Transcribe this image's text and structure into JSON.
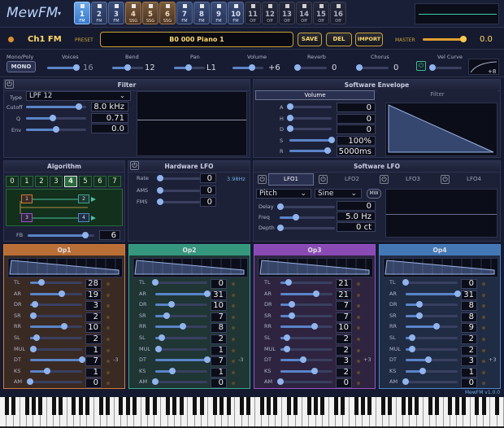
{
  "app": {
    "logo": "MewFM",
    "version": "MewFM v1.0.0"
  },
  "channel_tabs": [
    {
      "num": "1",
      "type": "FM",
      "state": "selected"
    },
    {
      "num": "2",
      "type": "FM",
      "state": "fm"
    },
    {
      "num": "3",
      "type": "FM",
      "state": "fm"
    },
    {
      "num": "4",
      "type": "SSG",
      "state": "ssg"
    },
    {
      "num": "5",
      "type": "SSG",
      "state": "ssg"
    },
    {
      "num": "6",
      "type": "SSG",
      "state": "ssg"
    },
    {
      "num": "7",
      "type": "FM",
      "state": "fm"
    },
    {
      "num": "8",
      "type": "FM",
      "state": "fm"
    },
    {
      "num": "9",
      "type": "FM",
      "state": "fm"
    },
    {
      "num": "10",
      "type": "FM",
      "state": "fm"
    },
    {
      "num": "11",
      "type": "Off",
      "state": "off"
    },
    {
      "num": "12",
      "type": "Off",
      "state": "off"
    },
    {
      "num": "13",
      "type": "Off",
      "state": "off"
    },
    {
      "num": "14",
      "type": "Off",
      "state": "off"
    },
    {
      "num": "15",
      "type": "Off",
      "state": "off"
    },
    {
      "num": "16",
      "type": "Off",
      "state": "off"
    }
  ],
  "preset_bar": {
    "channel_name": "Ch1 FM",
    "preset_label": "PRESET",
    "preset_value": "B0 000 Piano 1",
    "save": "SAVE",
    "del": "DEL",
    "import": "IMPORT",
    "master_label": "MASTER",
    "master_value": "0.0",
    "master_level": 0.93
  },
  "globals": {
    "mono_poly_label": "Mono/Poly",
    "mono_btn": "MONO",
    "voices_label": "Voices",
    "voices_value": "16",
    "voices_level": 0.95,
    "bend_label": "Bend",
    "bend_value": "12",
    "bend_level": 0.5,
    "pan_label": "Pan",
    "pan_value": "L1",
    "pan_level": 0.48,
    "volume_label": "Volume",
    "volume_value": "+6",
    "volume_level": 0.62,
    "reverb_label": "Reverb",
    "reverb_value": "0",
    "reverb_level": 0.05,
    "chorus_label": "Chorus",
    "chorus_value": "0",
    "chorus_level": 0.05,
    "velcurve_label": "Vel Curve",
    "velcurve_value": "+8"
  },
  "filter": {
    "title": "Filter",
    "type_label": "Type",
    "type_value": "LPF 12",
    "cutoff_label": "Cutoff",
    "cutoff_value": "8.0 kHz",
    "cutoff_level": 0.88,
    "q_label": "Q",
    "q_value": "0.71",
    "q_level": 0.45,
    "env_label": "Env",
    "env_value": "0.0",
    "env_level": 0.5
  },
  "envelope": {
    "title": "Software Envelope",
    "tab_volume": "Volume",
    "tab_filter": "Filter",
    "rows": [
      {
        "label": "A",
        "value": "0",
        "level": 0.02
      },
      {
        "label": "H",
        "value": "0",
        "level": 0.02
      },
      {
        "label": "D",
        "value": "0",
        "level": 0.02
      },
      {
        "label": "S",
        "value": "100%",
        "level": 1.0
      },
      {
        "label": "R",
        "value": "5000ms",
        "level": 0.9
      }
    ]
  },
  "algorithm": {
    "title": "Algorithm",
    "options": [
      "0",
      "1",
      "2",
      "3",
      "4",
      "5",
      "6",
      "7"
    ],
    "selected": "4",
    "fb_label": "FB",
    "fb_value": "6",
    "fb_level": 0.86,
    "ops": [
      "1",
      "2",
      "3",
      "4"
    ]
  },
  "hw_lfo": {
    "title": "Hardware LFO",
    "rate_label": "Rate",
    "rate_value": "0",
    "rate_hz": "3.98Hz",
    "ams_label": "AMS",
    "ams_value": "0",
    "fms_label": "FMS",
    "fms_value": "0"
  },
  "sw_lfo": {
    "title": "Software LFO",
    "tabs": [
      "LFO1",
      "LFO2",
      "LFO3",
      "LFO4"
    ],
    "target": "Pitch",
    "wave": "Sine",
    "mw": "MW",
    "delay_label": "Delay",
    "delay_value": "0",
    "delay_level": 0.02,
    "freq_label": "Freq",
    "freq_value": "5.0 Hz",
    "freq_level": 0.3,
    "depth_label": "Depth",
    "depth_value": "0 ct",
    "depth_level": 0.02
  },
  "param_labels": [
    "TL",
    "AR",
    "DR",
    "SR",
    "RR",
    "SL",
    "MUL",
    "DT",
    "KS",
    "AM"
  ],
  "operators": [
    {
      "title": "Op1",
      "color": "#d07a3a",
      "bg": "#3a2a24",
      "values": [
        "28",
        "19",
        "3",
        "2",
        "10",
        "2",
        "1",
        "7",
        "1",
        "0"
      ],
      "levels": [
        0.22,
        0.61,
        0.1,
        0.06,
        0.66,
        0.13,
        0.07,
        1.0,
        0.33,
        0.0
      ],
      "dt_extra": "-3"
    },
    {
      "title": "Op2",
      "color": "#3aa88a",
      "bg": "#1f3634",
      "values": [
        "0",
        "31",
        "10",
        "7",
        "8",
        "2",
        "1",
        "7",
        "1",
        "0"
      ],
      "levels": [
        0.0,
        1.0,
        0.32,
        0.22,
        0.53,
        0.13,
        0.07,
        1.0,
        0.33,
        0.0
      ],
      "dt_extra": "-3"
    },
    {
      "title": "Op3",
      "color": "#9a52c8",
      "bg": "#2e2440",
      "values": [
        "21",
        "21",
        "7",
        "7",
        "10",
        "2",
        "2",
        "3",
        "2",
        "0"
      ],
      "levels": [
        0.16,
        0.68,
        0.22,
        0.22,
        0.66,
        0.13,
        0.13,
        0.43,
        0.66,
        0.0
      ],
      "dt_extra": "+3"
    },
    {
      "title": "Op4",
      "color": "#4a86c8",
      "bg": "#202c44",
      "values": [
        "0",
        "31",
        "8",
        "8",
        "9",
        "2",
        "2",
        "3",
        "1",
        "0"
      ],
      "levels": [
        0.0,
        1.0,
        0.26,
        0.26,
        0.6,
        0.13,
        0.13,
        0.43,
        0.33,
        0.0
      ],
      "dt_extra": "+3"
    }
  ]
}
